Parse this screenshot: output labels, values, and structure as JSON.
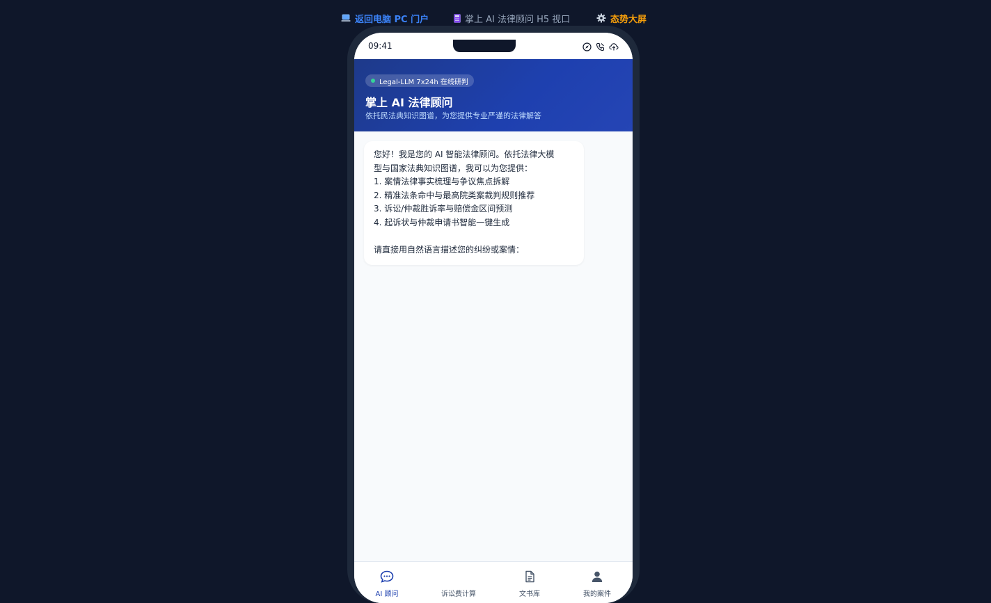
{
  "topnav": {
    "back_label": "返回电脑 PC 门户",
    "view_label": "掌上 AI 法律顾问 H5 视口",
    "dashboard_label": "态势大屏"
  },
  "statusbar": {
    "time": "09:41"
  },
  "header": {
    "badge": "Legal-LLM 7x24h 在线研判",
    "title": "掌上 AI 法律顾问",
    "subtitle": "依托民法典知识图谱，为您提供专业严谨的法律解答"
  },
  "chat": {
    "message_lines": [
      "您好！我是您的 AI 智能法律顾问。依托法律大模",
      "型与国家法典知识图谱，我可以为您提供：",
      "1. 案情法律事实梳理与争议焦点拆解",
      "2. 精准法条命中与最高院类案裁判规则推荐",
      "3. 诉讼/仲裁胜诉率与赔偿金区间预测",
      "4. 起诉状与仲裁申请书智能一键生成"
    ],
    "message_closing": "请直接用自然语言描述您的纠纷或案情："
  },
  "tabs": [
    {
      "label": "AI 顾问",
      "icon": "chat-icon"
    },
    {
      "label": "诉讼费计算",
      "icon": "calculator-icon"
    },
    {
      "label": "文书库",
      "icon": "document-icon"
    },
    {
      "label": "我的案件",
      "icon": "user-icon"
    }
  ],
  "colors": {
    "page_bg": "#0f172a",
    "accent_blue": "#3b82f6",
    "accent_orange": "#f59e0b",
    "header_blue": "#1e40af",
    "online_green": "#34d399"
  }
}
